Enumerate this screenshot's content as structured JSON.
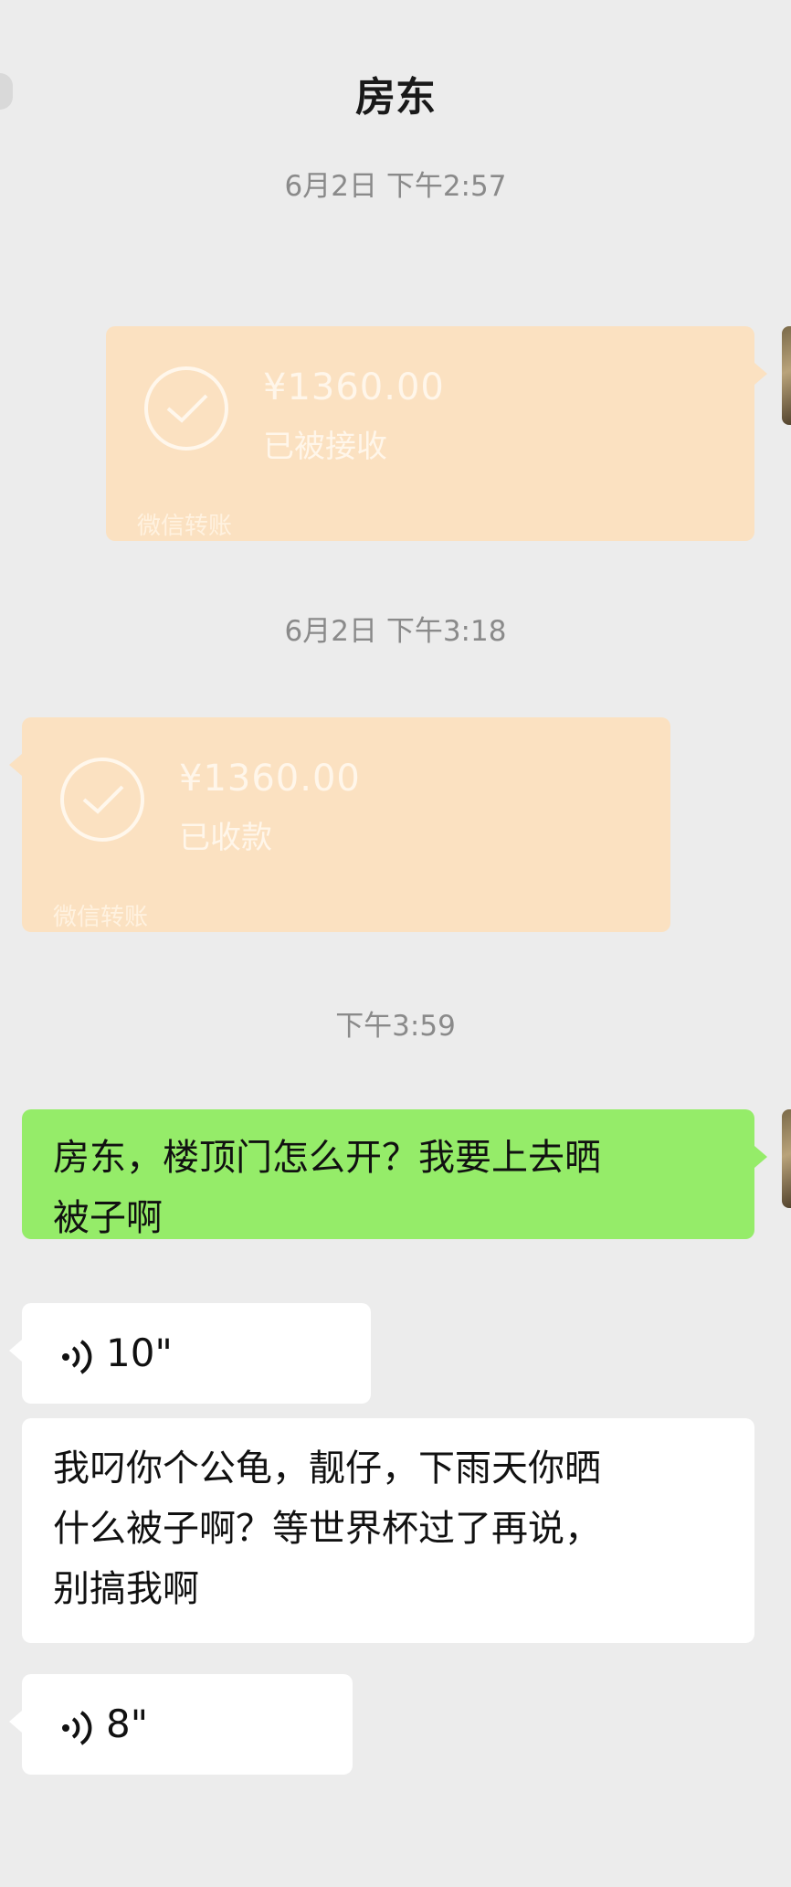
{
  "header": {
    "title": "房东"
  },
  "messages": {
    "ts1": "6月2日 下午2:57",
    "transfer1": {
      "amount": "¥1360.00",
      "status": "已被接收",
      "footer": "微信转账"
    },
    "ts2": "6月2日 下午3:18",
    "transfer2": {
      "amount": "¥1360.00",
      "status": "已收款",
      "footer": "微信转账"
    },
    "ts3": "下午3:59",
    "text1": {
      "line1": "房东，楼顶门怎么开？我要上去晒",
      "line2": "被子啊"
    },
    "voice1": {
      "duration": "10\""
    },
    "text2": {
      "line1": "我叼你个公龟，靓仔，下雨天你晒",
      "line2": "什么被子啊？等世界杯过了再说，",
      "line3": "别搞我啊"
    },
    "voice2": {
      "duration": "8\""
    }
  },
  "colors": {
    "background": "#ececec",
    "transfer_bubble": "#fbe1c1",
    "sent_bubble": "#95ec69",
    "received_bubble": "#ffffff"
  },
  "icons": {
    "back": "back-dot-icon",
    "transfer": "check-circle-icon",
    "voice": "voice-wave-icon"
  }
}
